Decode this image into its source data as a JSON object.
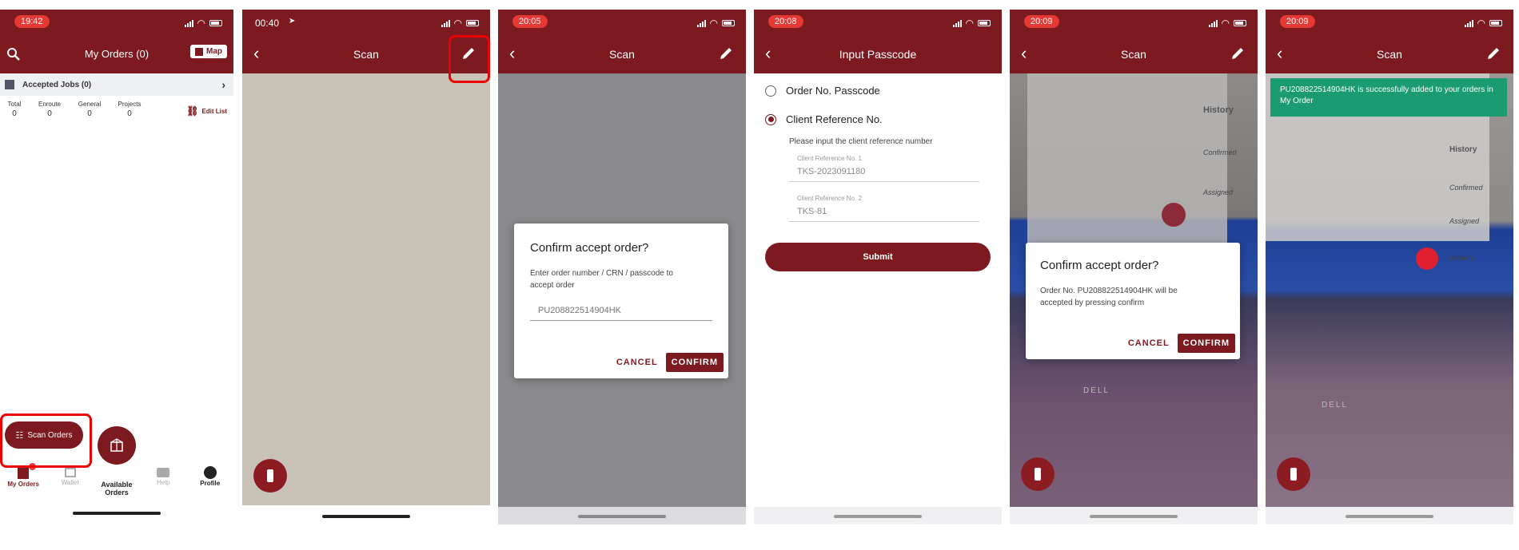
{
  "colors": {
    "brand": "#7d1a1f",
    "highlight": "#ee0000",
    "toast": "#1a9b72"
  },
  "s1": {
    "time": "19:42",
    "title": "My Orders (0)",
    "map_label": "Map",
    "accepted_jobs": "Accepted Jobs (0)",
    "stats": [
      {
        "label": "Total",
        "value": "0"
      },
      {
        "label": "Enroute",
        "value": "0"
      },
      {
        "label": "General",
        "value": "0"
      },
      {
        "label": "Projects",
        "value": "0"
      }
    ],
    "edit_list": "Edit List",
    "scan_orders": "Scan Orders",
    "tabs": [
      {
        "label": "My Orders",
        "icon": "orders-icon"
      },
      {
        "label": "Wallet",
        "icon": "wallet-icon"
      },
      {
        "label": "Available Orders",
        "icon": "box-icon"
      },
      {
        "label": "Help",
        "icon": "chat-icon"
      },
      {
        "label": "Profile",
        "icon": "profile-icon"
      }
    ]
  },
  "s2": {
    "time": "00:40",
    "title": "Scan"
  },
  "s3": {
    "time": "20:05",
    "title": "Scan",
    "dialog_title": "Confirm accept order?",
    "dialog_text": "Enter order number / CRN / passcode to accept order",
    "input_placeholder": "PU208822514904HK",
    "cancel": "CANCEL",
    "confirm": "CONFIRM"
  },
  "s4": {
    "time": "20:08",
    "title": "Input Passcode",
    "option1": "Order No. Passcode",
    "option2": "Client Reference No.",
    "hint": "Please input the client reference number",
    "field1_label": "Client Reference No. 1",
    "field1_value": "TKS-2023091180",
    "field2_label": "Client Reference No. 2",
    "field2_value": "TKS-81",
    "submit": "Submit"
  },
  "s5": {
    "time": "20:09",
    "title": "Scan",
    "dialog_title": "Confirm accept order?",
    "dialog_text": "Order No. PU208822514904HK will be accepted by pressing confirm",
    "cancel": "CANCEL",
    "confirm": "CONFIRM",
    "bg_history": "History",
    "bg_confirmed": "Confirmed",
    "bg_assigned": "Assigned",
    "bg_dell": "DELL"
  },
  "s6": {
    "time": "20:09",
    "title": "Scan",
    "toast": "PU208822514904HK is successfully added to your orders in My Order",
    "bg_history": "History",
    "bg_confirmed": "Confirmed",
    "bg_assigned": "Assigned",
    "bg_delivery": "delivery",
    "bg_dell": "DELL"
  }
}
